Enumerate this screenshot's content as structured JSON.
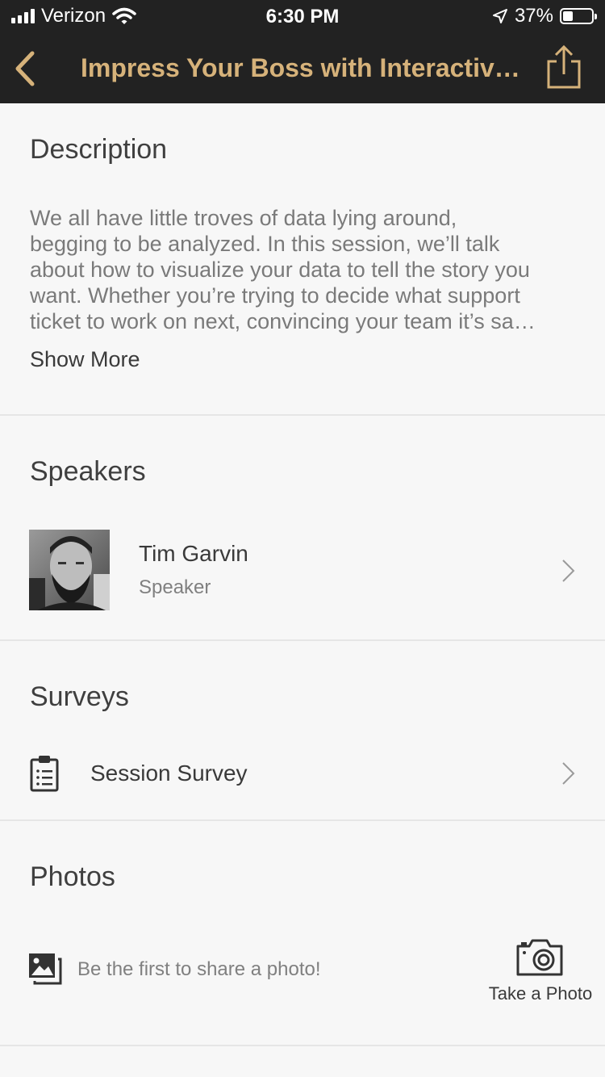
{
  "status_bar": {
    "carrier": "Verizon",
    "time": "6:30 PM",
    "battery": "37%"
  },
  "nav": {
    "title": "Impress Your Boss with Interactive Data Visualizations",
    "back_icon": "chevron-left-icon",
    "share_icon": "share-icon"
  },
  "description": {
    "heading": "Description",
    "lines": [
      "We all have little troves of data lying around,",
      "begging to be analyzed. In this session, we’ll talk",
      "about how to visualize your data to tell the story you",
      "want. Whether you’re trying to decide what support",
      "ticket to work on next, convincing your team it’s sa…"
    ],
    "show_more": "Show More"
  },
  "speakers": {
    "heading": "Speakers",
    "items": [
      {
        "name": "Tim Garvin",
        "role": "Speaker"
      }
    ]
  },
  "surveys": {
    "heading": "Surveys",
    "items": [
      {
        "label": "Session Survey",
        "icon": "clipboard-icon"
      }
    ]
  },
  "photos": {
    "heading": "Photos",
    "empty_text": "Be the first to share a photo!",
    "take_photo_label": "Take a Photo",
    "icon": "photos-icon",
    "camera_icon": "camera-icon"
  },
  "colors": {
    "header_bg": "#222222",
    "accent": "#d6b27a",
    "page_bg": "#f7f7f7"
  }
}
